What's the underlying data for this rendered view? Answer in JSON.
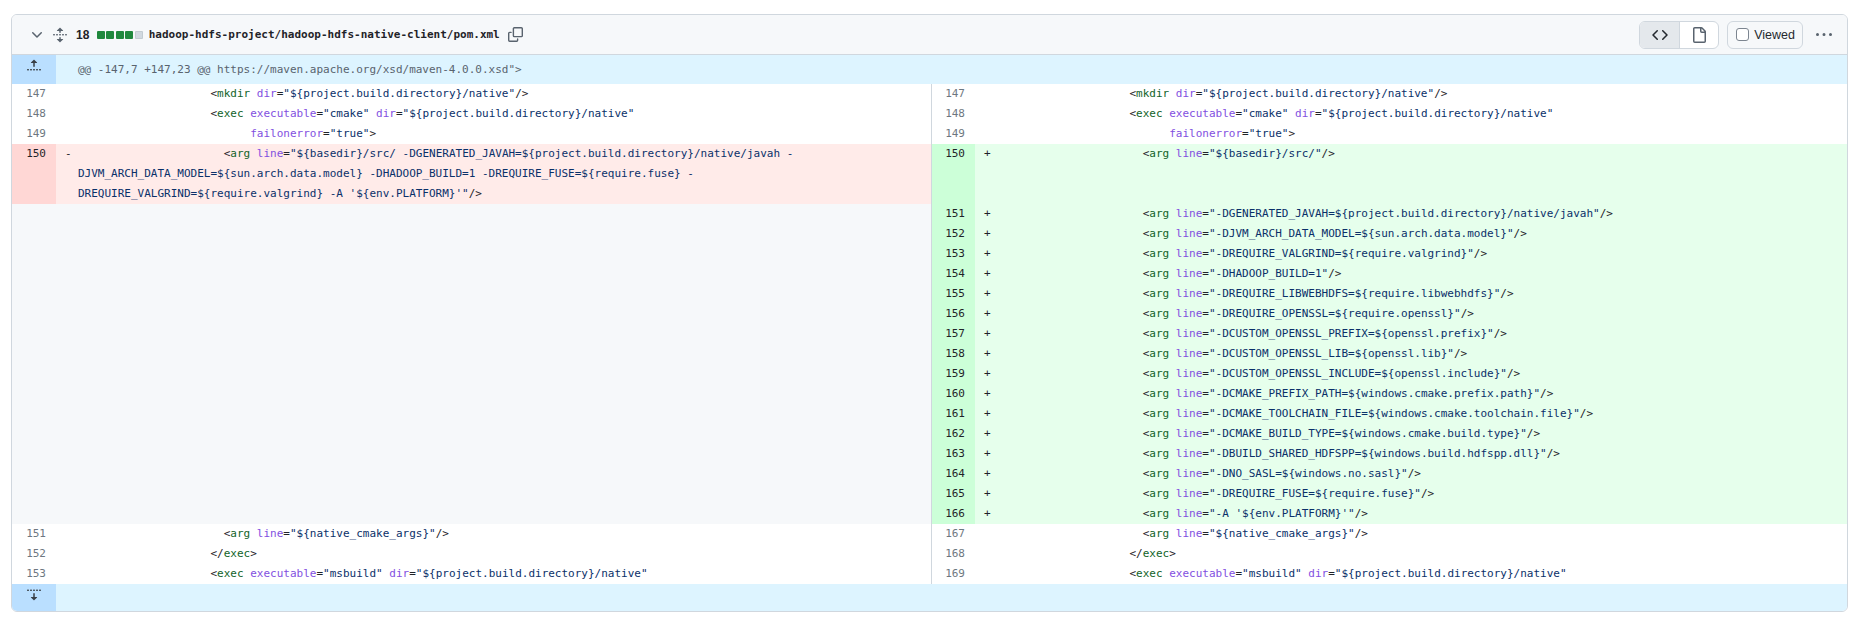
{
  "file_header": {
    "changes_count": "18",
    "diffstat": {
      "total_squares": 5,
      "added_squares": 4,
      "neutral_squares": 1
    },
    "file_path": "hadoop-hdfs-project/hadoop-hdfs-native-client/pom.xml",
    "viewed_label": "Viewed",
    "viewed_checked": false,
    "icons": {
      "collapse": "chevron-down",
      "expand_all": "unfold",
      "copy_path": "copy",
      "source_view": "code",
      "rich_view": "file",
      "more_options": "kebab-horizontal"
    }
  },
  "hunk_header": "@@ -147,7 +147,23 @@ https://maven.apache.org/xsd/maven-4.0.0.xsd\">",
  "colors": {
    "addition_bg": "#e6ffec",
    "addition_num_bg": "#ccffd8",
    "deletion_bg": "#ffebe9",
    "deletion_num_bg": "#ffd7d5",
    "hunk_bg": "#ddf4ff",
    "hunk_num_bg": "#badfff",
    "empty_bg": "#f6f8fa",
    "header_bg": "#f6f8fa",
    "border": "#d0d7de",
    "tag_color": "#116329",
    "attribute_color": "#8250df",
    "string_color": "#0a3069",
    "diffstat_added": "#1f883d",
    "diffstat_neutral": "#d1d9e0"
  },
  "diff_rows": [
    {
      "left": {
        "num": "147",
        "type": "context",
        "code": "                    <mkdir dir=\"${project.build.directory}/native\"/>"
      },
      "right": {
        "num": "147",
        "type": "context",
        "code": "                    <mkdir dir=\"${project.build.directory}/native\"/>"
      }
    },
    {
      "left": {
        "num": "148",
        "type": "context",
        "code": "                    <exec executable=\"cmake\" dir=\"${project.build.directory}/native\""
      },
      "right": {
        "num": "148",
        "type": "context",
        "code": "                    <exec executable=\"cmake\" dir=\"${project.build.directory}/native\""
      }
    },
    {
      "left": {
        "num": "149",
        "type": "context",
        "code": "                          failonerror=\"true\">"
      },
      "right": {
        "num": "149",
        "type": "context",
        "code": "                          failonerror=\"true\">"
      }
    },
    {
      "left": {
        "num": "150",
        "type": "deletion",
        "marker": "-",
        "code": "                      <arg line=\"${basedir}/src/ -DGENERATED_JAVAH=${project.build.directory}/native/javah -DJVM_ARCH_DATA_MODEL=${sun.arch.data.model} -DHADOOP_BUILD=1 -DREQUIRE_FUSE=${require.fuse} -DREQUIRE_VALGRIND=${require.valgrind} -A '${env.PLATFORM}'\"/>"
      },
      "right": {
        "num": "150",
        "type": "addition",
        "marker": "+",
        "code": "                      <arg line=\"${basedir}/src/\"/>"
      }
    },
    {
      "left": {
        "type": "empty"
      },
      "right": {
        "num": "151",
        "type": "addition",
        "marker": "+",
        "code": "                      <arg line=\"-DGENERATED_JAVAH=${project.build.directory}/native/javah\"/>"
      }
    },
    {
      "left": {
        "type": "empty"
      },
      "right": {
        "num": "152",
        "type": "addition",
        "marker": "+",
        "code": "                      <arg line=\"-DJVM_ARCH_DATA_MODEL=${sun.arch.data.model}\"/>"
      }
    },
    {
      "left": {
        "type": "empty"
      },
      "right": {
        "num": "153",
        "type": "addition",
        "marker": "+",
        "code": "                      <arg line=\"-DREQUIRE_VALGRIND=${require.valgrind}\"/>"
      }
    },
    {
      "left": {
        "type": "empty"
      },
      "right": {
        "num": "154",
        "type": "addition",
        "marker": "+",
        "code": "                      <arg line=\"-DHADOOP_BUILD=1\"/>"
      }
    },
    {
      "left": {
        "type": "empty"
      },
      "right": {
        "num": "155",
        "type": "addition",
        "marker": "+",
        "code": "                      <arg line=\"-DREQUIRE_LIBWEBHDFS=${require.libwebhdfs}\"/>"
      }
    },
    {
      "left": {
        "type": "empty"
      },
      "right": {
        "num": "156",
        "type": "addition",
        "marker": "+",
        "code": "                      <arg line=\"-DREQUIRE_OPENSSL=${require.openssl}\"/>"
      }
    },
    {
      "left": {
        "type": "empty"
      },
      "right": {
        "num": "157",
        "type": "addition",
        "marker": "+",
        "code": "                      <arg line=\"-DCUSTOM_OPENSSL_PREFIX=${openssl.prefix}\"/>"
      }
    },
    {
      "left": {
        "type": "empty"
      },
      "right": {
        "num": "158",
        "type": "addition",
        "marker": "+",
        "code": "                      <arg line=\"-DCUSTOM_OPENSSL_LIB=${openssl.lib}\"/>"
      }
    },
    {
      "left": {
        "type": "empty"
      },
      "right": {
        "num": "159",
        "type": "addition",
        "marker": "+",
        "code": "                      <arg line=\"-DCUSTOM_OPENSSL_INCLUDE=${openssl.include}\"/>"
      }
    },
    {
      "left": {
        "type": "empty"
      },
      "right": {
        "num": "160",
        "type": "addition",
        "marker": "+",
        "code": "                      <arg line=\"-DCMAKE_PREFIX_PATH=${windows.cmake.prefix.path}\"/>"
      }
    },
    {
      "left": {
        "type": "empty"
      },
      "right": {
        "num": "161",
        "type": "addition",
        "marker": "+",
        "code": "                      <arg line=\"-DCMAKE_TOOLCHAIN_FILE=${windows.cmake.toolchain.file}\"/>"
      }
    },
    {
      "left": {
        "type": "empty"
      },
      "right": {
        "num": "162",
        "type": "addition",
        "marker": "+",
        "code": "                      <arg line=\"-DCMAKE_BUILD_TYPE=${windows.cmake.build.type}\"/>"
      }
    },
    {
      "left": {
        "type": "empty"
      },
      "right": {
        "num": "163",
        "type": "addition",
        "marker": "+",
        "code": "                      <arg line=\"-DBUILD_SHARED_HDFSPP=${windows.build.hdfspp.dll}\"/>"
      }
    },
    {
      "left": {
        "type": "empty"
      },
      "right": {
        "num": "164",
        "type": "addition",
        "marker": "+",
        "code": "                      <arg line=\"-DNO_SASL=${windows.no.sasl}\"/>"
      }
    },
    {
      "left": {
        "type": "empty"
      },
      "right": {
        "num": "165",
        "type": "addition",
        "marker": "+",
        "code": "                      <arg line=\"-DREQUIRE_FUSE=${require.fuse}\"/>"
      }
    },
    {
      "left": {
        "type": "empty"
      },
      "right": {
        "num": "166",
        "type": "addition",
        "marker": "+",
        "code": "                      <arg line=\"-A '${env.PLATFORM}'\"/>"
      }
    },
    {
      "left": {
        "num": "151",
        "type": "context",
        "code": "                      <arg line=\"${native_cmake_args}\"/>"
      },
      "right": {
        "num": "167",
        "type": "context",
        "code": "                      <arg line=\"${native_cmake_args}\"/>"
      }
    },
    {
      "left": {
        "num": "152",
        "type": "context",
        "code": "                    </exec>"
      },
      "right": {
        "num": "168",
        "type": "context",
        "code": "                    </exec>"
      }
    },
    {
      "left": {
        "num": "153",
        "type": "context",
        "code": "                    <exec executable=\"msbuild\" dir=\"${project.build.directory}/native\""
      },
      "right": {
        "num": "169",
        "type": "context",
        "code": "                    <exec executable=\"msbuild\" dir=\"${project.build.directory}/native\""
      }
    }
  ]
}
